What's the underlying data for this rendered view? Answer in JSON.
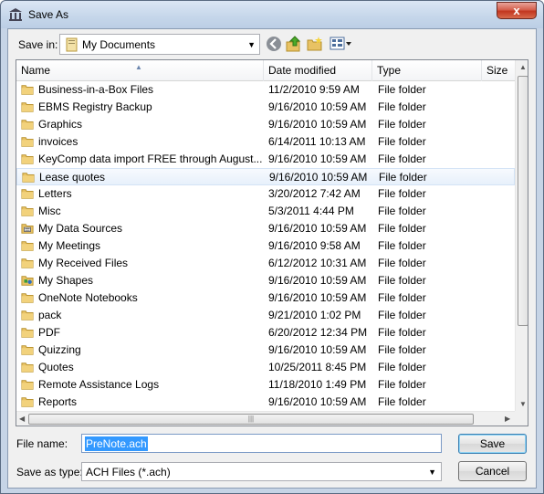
{
  "window": {
    "title": "Save As",
    "close_glyph": "x"
  },
  "toolbar": {
    "save_in_label": "Save in:",
    "save_in_value": "My Documents",
    "icons": [
      "back-icon",
      "up-folder-icon",
      "new-folder-icon",
      "view-menu-icon"
    ]
  },
  "columns": [
    "Name",
    "Date modified",
    "Type",
    "Size"
  ],
  "files": [
    {
      "name": "Business-in-a-Box Files",
      "date": "11/2/2010 9:59 AM",
      "type": "File folder",
      "icon": "folder"
    },
    {
      "name": "EBMS Registry Backup",
      "date": "9/16/2010 10:59 AM",
      "type": "File folder",
      "icon": "folder"
    },
    {
      "name": "Graphics",
      "date": "9/16/2010 10:59 AM",
      "type": "File folder",
      "icon": "folder"
    },
    {
      "name": "invoices",
      "date": "6/14/2011 10:13 AM",
      "type": "File folder",
      "icon": "folder"
    },
    {
      "name": "KeyComp data import FREE through August...",
      "date": "9/16/2010 10:59 AM",
      "type": "File folder",
      "icon": "folder"
    },
    {
      "name": "Lease quotes",
      "date": "9/16/2010 10:59 AM",
      "type": "File folder",
      "icon": "folder",
      "hover": true
    },
    {
      "name": "Letters",
      "date": "3/20/2012 7:42 AM",
      "type": "File folder",
      "icon": "folder"
    },
    {
      "name": "Misc",
      "date": "5/3/2011 4:44 PM",
      "type": "File folder",
      "icon": "folder"
    },
    {
      "name": "My Data Sources",
      "date": "9/16/2010 10:59 AM",
      "type": "File folder",
      "icon": "data-source"
    },
    {
      "name": "My Meetings",
      "date": "9/16/2010 9:58 AM",
      "type": "File folder",
      "icon": "folder"
    },
    {
      "name": "My Received Files",
      "date": "6/12/2012 10:31 AM",
      "type": "File folder",
      "icon": "folder"
    },
    {
      "name": "My Shapes",
      "date": "9/16/2010 10:59 AM",
      "type": "File folder",
      "icon": "shapes"
    },
    {
      "name": "OneNote Notebooks",
      "date": "9/16/2010 10:59 AM",
      "type": "File folder",
      "icon": "folder"
    },
    {
      "name": "pack",
      "date": "9/21/2010 1:02 PM",
      "type": "File folder",
      "icon": "folder"
    },
    {
      "name": "PDF",
      "date": "6/20/2012 12:34 PM",
      "type": "File folder",
      "icon": "folder"
    },
    {
      "name": "Quizzing",
      "date": "9/16/2010 10:59 AM",
      "type": "File folder",
      "icon": "folder"
    },
    {
      "name": "Quotes",
      "date": "10/25/2011 8:45 PM",
      "type": "File folder",
      "icon": "folder"
    },
    {
      "name": "Remote Assistance Logs",
      "date": "11/18/2010 1:49 PM",
      "type": "File folder",
      "icon": "folder"
    },
    {
      "name": "Reports",
      "date": "9/16/2010 10:59 AM",
      "type": "File folder",
      "icon": "folder"
    }
  ],
  "footer": {
    "file_name_label": "File name:",
    "file_name_value": "PreNote.ach",
    "save_as_type_label": "Save as type:",
    "save_as_type_value": "ACH Files (*.ach)",
    "save_button": "Save",
    "cancel_button": "Cancel"
  },
  "colors": {
    "folder": "#e8c264",
    "selection": "#3399ff",
    "hover": "#e7f0fb"
  }
}
